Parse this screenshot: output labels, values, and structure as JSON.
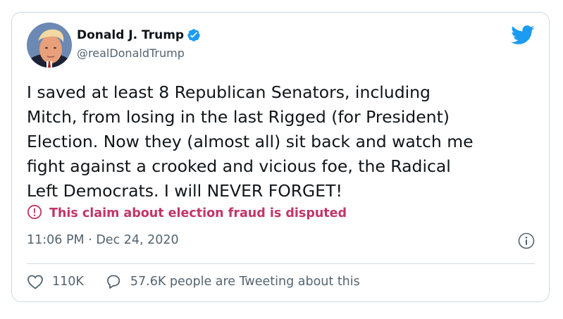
{
  "tweet": {
    "author_name": "Donald J. Trump",
    "handle": "@realDonaldTrump",
    "verified": true,
    "text": "I saved at least 8 Republican Senators, including\nMitch, from losing in the last Rigged (for President)\nElection. Now they (almost all) sit back and watch me\nfight against a crooked and vicious foe, the Radical\nLeft Democrats. I will NEVER FORGET!",
    "label": "This claim about election fraud is disputed",
    "timestamp": "11:06 PM · Dec 24, 2020",
    "likes": "110K",
    "tweeting_about": "57.6K people are Tweeting about this"
  },
  "icons": {
    "brand": "twitter-bird-icon",
    "verified": "verified-badge-icon",
    "label": "exclamation-circle-icon",
    "info": "info-icon",
    "like": "heart-icon",
    "reply": "comment-bubble-icon"
  },
  "colors": {
    "brand_blue": "#1d9bf0",
    "label_red": "#c13567",
    "text_primary": "#0f1419",
    "text_secondary": "#536471",
    "border": "#cfd9de"
  }
}
